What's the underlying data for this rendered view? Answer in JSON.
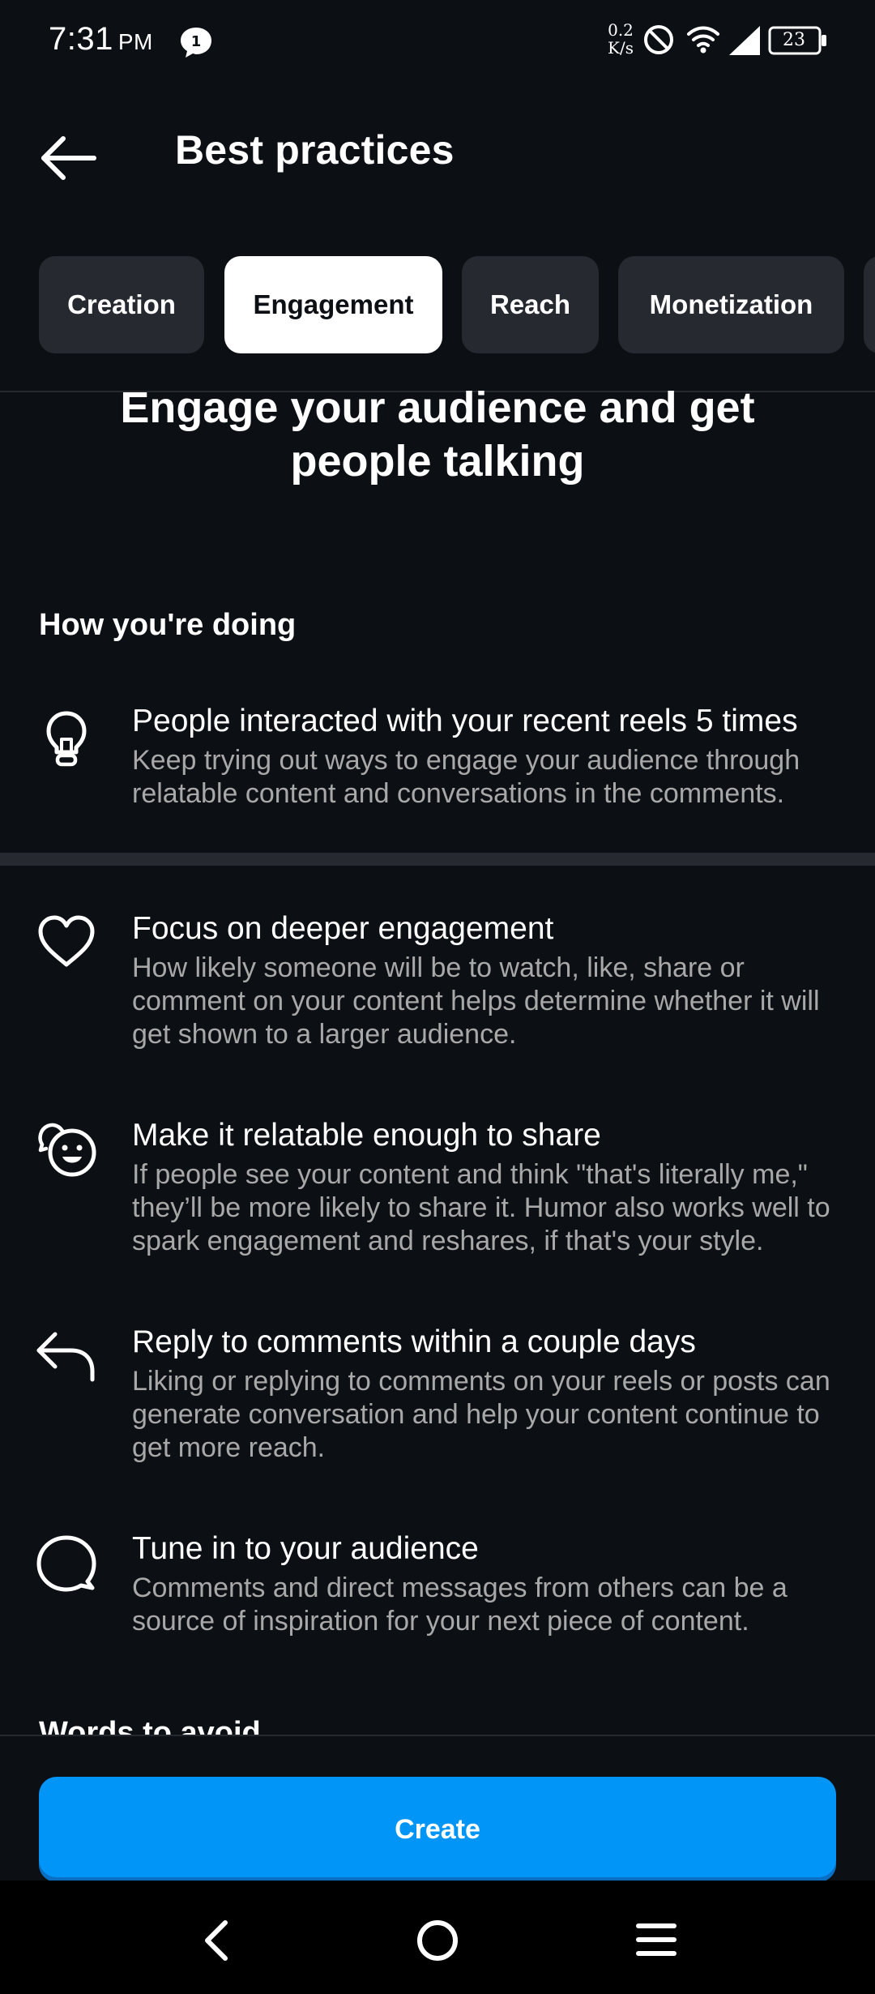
{
  "status_bar": {
    "time": "7:31",
    "ampm": "PM",
    "notification_count": "1",
    "net_speed_value": "0.2",
    "net_speed_unit": "K/s",
    "battery": "23"
  },
  "header": {
    "title": "Best practices"
  },
  "tabs": [
    {
      "label": "Creation",
      "active": false
    },
    {
      "label": "Engagement",
      "active": true
    },
    {
      "label": "Reach",
      "active": false
    },
    {
      "label": "Monetization",
      "active": false
    }
  ],
  "headline": "Engage your audience and get people talking",
  "how_youre_doing": {
    "heading": "How you're doing",
    "stat": {
      "icon": "lightbulb-icon",
      "title": "People interacted with your recent reels 5 times",
      "description": "Keep trying out ways to engage your audience through relatable content and conversations in the comments."
    }
  },
  "tips": [
    {
      "icon": "heart-icon",
      "title": "Focus on deeper engagement",
      "description": "How likely someone will be to watch, like, share or comment on your content helps determine whether it will get shown to a larger audience."
    },
    {
      "icon": "smiley-bubbles-icon",
      "title": "Make it relatable enough to share",
      "description": "If people see your content and think \"that's literally me,\" they’ll be more likely to share it. Humor also works well to spark engagement and reshares, if that's your style."
    },
    {
      "icon": "reply-arrow-icon",
      "title": "Reply to comments within a couple days",
      "description": "Liking or replying to comments on your reels or posts can generate conversation and help your content continue to get more reach."
    },
    {
      "icon": "comment-bubble-icon",
      "title": "Tune in to your audience",
      "description": "Comments and direct messages from others can be a source of inspiration for your next piece of content."
    }
  ],
  "partial_next_heading": "Words to avoid",
  "create_button": {
    "label": "Create"
  },
  "colors": {
    "background": "#0c1014",
    "accent": "#0095f6",
    "tab_inactive": "#262a30",
    "secondary_text": "#a8a8a8"
  }
}
